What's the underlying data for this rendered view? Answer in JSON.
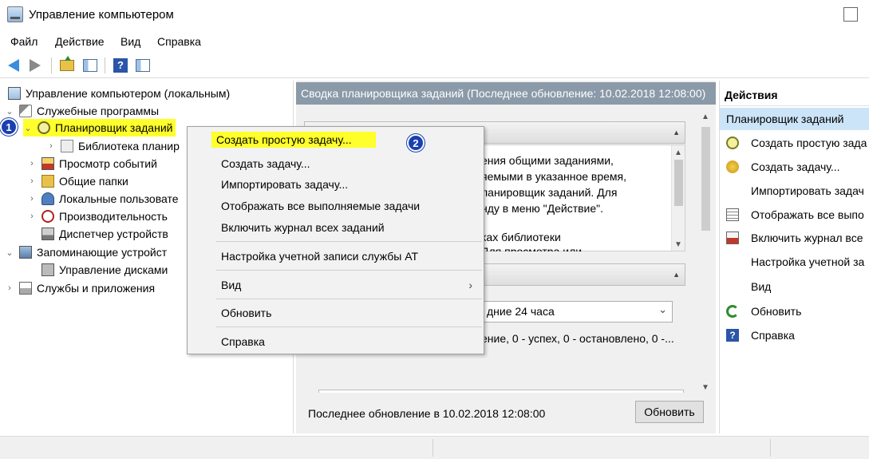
{
  "window": {
    "title": "Управление компьютером"
  },
  "menu": [
    "Файл",
    "Действие",
    "Вид",
    "Справка"
  ],
  "tree": {
    "root": "Управление компьютером (локальным)",
    "utilities": "Служебные программы",
    "scheduler": "Планировщик заданий",
    "library": "Библиотека планир",
    "events": "Просмотр событий",
    "shared": "Общие папки",
    "users": "Локальные пользовате",
    "performance": "Производительность",
    "devices": "Диспетчер устройств",
    "storage": "Запоминающие устройст",
    "disks": "Управление дисками",
    "services": "Службы и приложения"
  },
  "badges": {
    "one": "1",
    "two": "2"
  },
  "middle": {
    "header": "Сводка планировщика заданий (Последнее обновление: 10.02.2018 12:08:00)",
    "body_lines": [
      "ения общими заданиями,",
      "яемыми в указанное время,",
      "ланировщик заданий. Для",
      "нду в меню \"Действие\".",
      "",
      "ках библиотеки",
      "Для просмотра или"
    ],
    "select_value": "дние 24 часа",
    "status_line": "ение, 0 - успех, 0 - остановлено, 0 -...",
    "last_update": "Последнее обновление в 10.02.2018 12:08:00",
    "refresh_label": "Обновить"
  },
  "context_menu": {
    "create_basic": "Создать простую задачу...",
    "create": "Создать задачу...",
    "import": "Импортировать задачу...",
    "show_running": "Отображать все выполняемые задачи",
    "enable_log": "Включить журнал всех заданий",
    "at_account": "Настройка учетной записи службы AT",
    "view": "Вид",
    "refresh": "Обновить",
    "help": "Справка",
    "submenu_arrow": "›"
  },
  "actions": {
    "title": "Действия",
    "subtitle": "Планировщик заданий",
    "items": [
      "Создать простую зада",
      "Создать задачу...",
      "Импортировать задач",
      "Отображать все выпо",
      "Включить журнал все",
      "Настройка учетной за",
      "Вид",
      "Обновить",
      "Справка"
    ]
  },
  "icons": {
    "back": "back-arrow-icon",
    "forward": "forward-arrow-icon",
    "up": "folder-up-icon",
    "console_tree": "console-tree-icon",
    "help": "help-icon",
    "action_pane": "action-pane-icon"
  }
}
